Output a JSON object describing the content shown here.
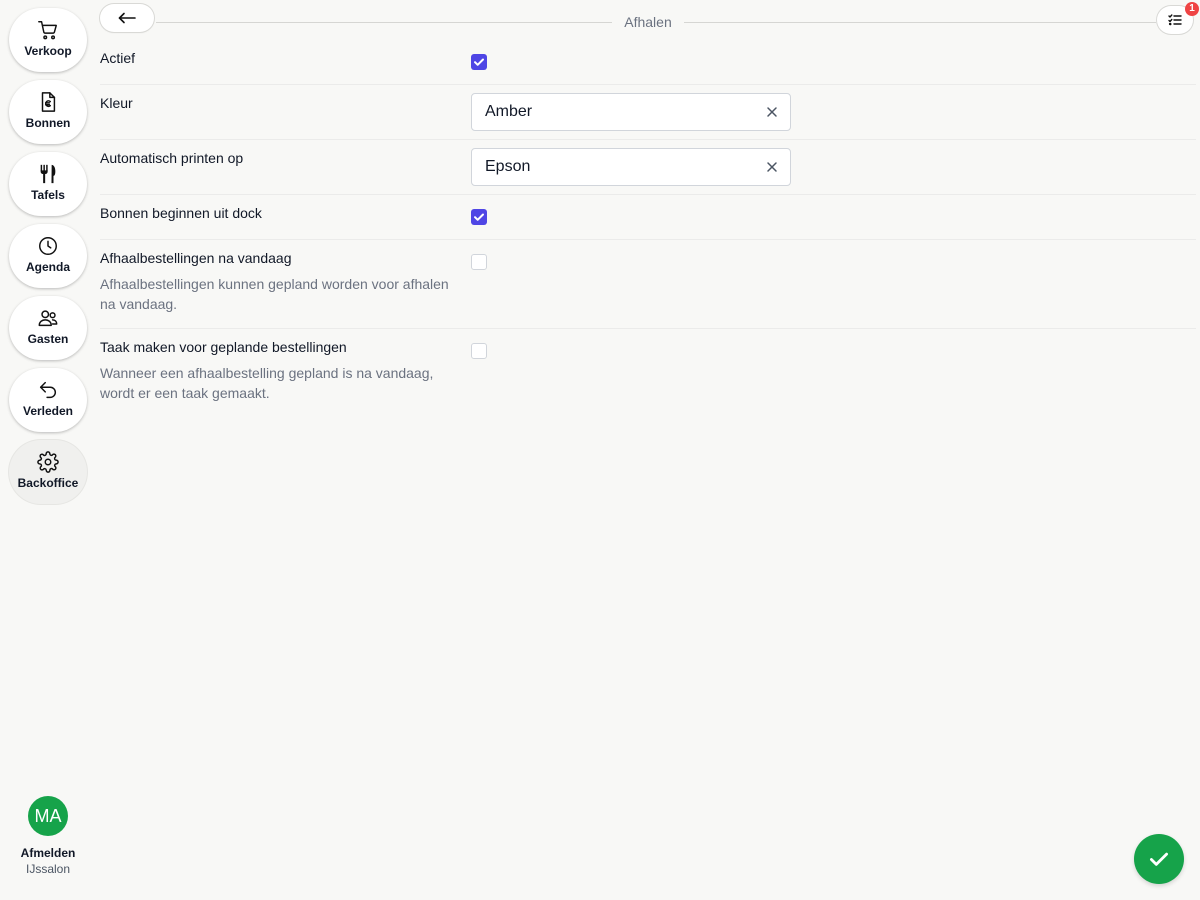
{
  "sidebar": {
    "items": [
      {
        "label": "Verkoop",
        "icon": "shopping-cart-icon"
      },
      {
        "label": "Bonnen",
        "icon": "receipt-euro-icon"
      },
      {
        "label": "Tafels",
        "icon": "utensils-icon"
      },
      {
        "label": "Agenda",
        "icon": "clock-icon"
      },
      {
        "label": "Gasten",
        "icon": "users-icon"
      },
      {
        "label": "Verleden",
        "icon": "undo-arrow-icon"
      },
      {
        "label": "Backoffice",
        "icon": "gear-icon",
        "active": true
      }
    ],
    "user": {
      "initials": "MA",
      "logout_label": "Afmelden",
      "organization": "IJssalon"
    }
  },
  "header": {
    "title": "Afhalen",
    "back_icon": "arrow-left-icon",
    "tasks_icon": "task-list-icon",
    "tasks_badge": "1"
  },
  "settings": {
    "actief": {
      "label": "Actief",
      "checked": true
    },
    "kleur": {
      "label": "Kleur",
      "value": "Amber"
    },
    "printen": {
      "label": "Automatisch printen op",
      "value": "Epson"
    },
    "dock": {
      "label": "Bonnen beginnen uit dock",
      "checked": true
    },
    "na_vandaag": {
      "label": "Afhaalbestellingen na vandaag",
      "description": "Afhaalbestellingen kunnen gepland worden voor afhalen na vandaag.",
      "checked": false
    },
    "taak": {
      "label": "Taak maken voor geplande bestellingen",
      "description": "Wanneer een afhaalbestelling gepland is na vandaag, wordt er een taak gemaakt.",
      "checked": false
    }
  },
  "colors": {
    "accent": "#4f46e5",
    "success": "#16a34a",
    "badge": "#ef4444"
  }
}
